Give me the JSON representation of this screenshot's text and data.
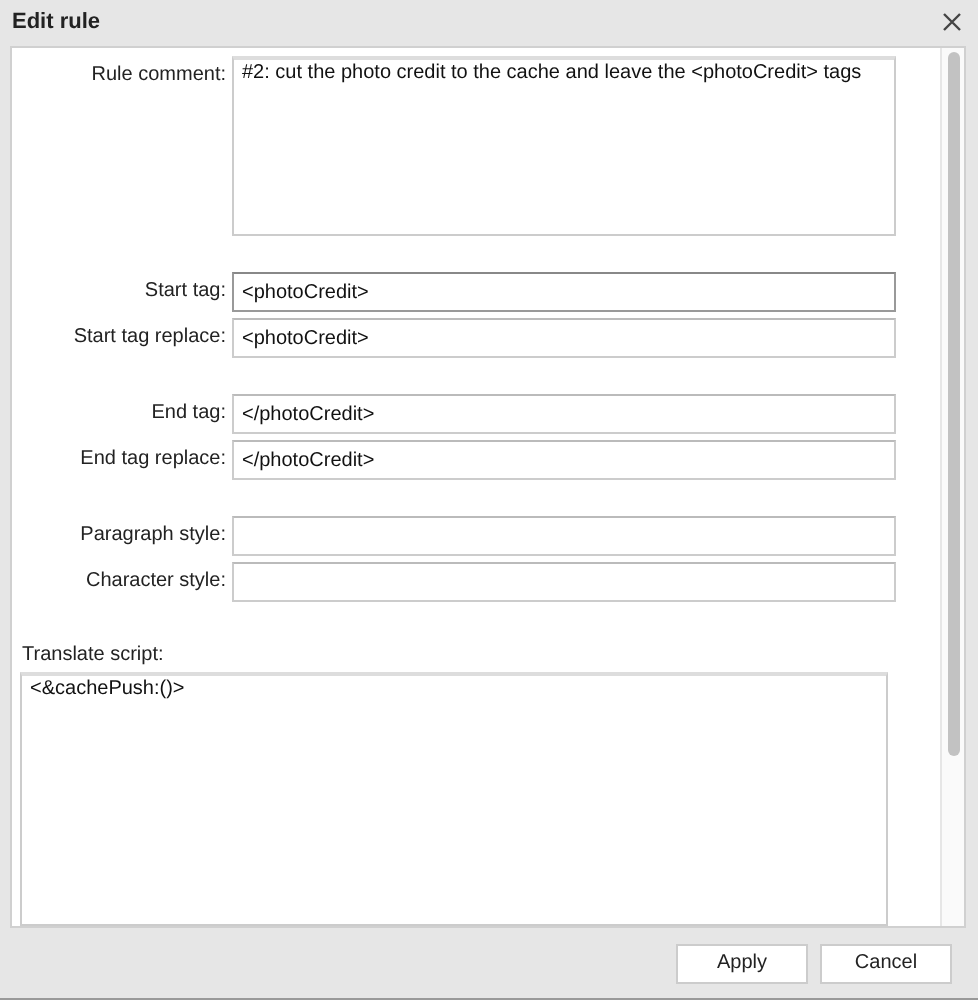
{
  "window": {
    "title": "Edit rule"
  },
  "rule_comment": {
    "label": "Rule comment:",
    "value": "#2: cut the photo credit to the cache and leave the <photoCredit> tags"
  },
  "field_groups": [
    [
      {
        "label": "Start tag:",
        "value": "<photoCredit>",
        "focused": true
      },
      {
        "label": "Start tag replace:",
        "value": "<photoCredit>",
        "focused": false
      }
    ],
    [
      {
        "label": "End tag:",
        "value": "</photoCredit>",
        "focused": false
      },
      {
        "label": "End tag replace:",
        "value": "</photoCredit>",
        "focused": false
      }
    ],
    [
      {
        "label": "Paragraph style:",
        "focused": false
      },
      {
        "label": "Character style:",
        "focused": false
      }
    ]
  ],
  "translate_script": {
    "label": "Translate script:",
    "value": "<&cachePush:()>"
  },
  "buttons": [
    "Apply",
    "Cancel"
  ]
}
